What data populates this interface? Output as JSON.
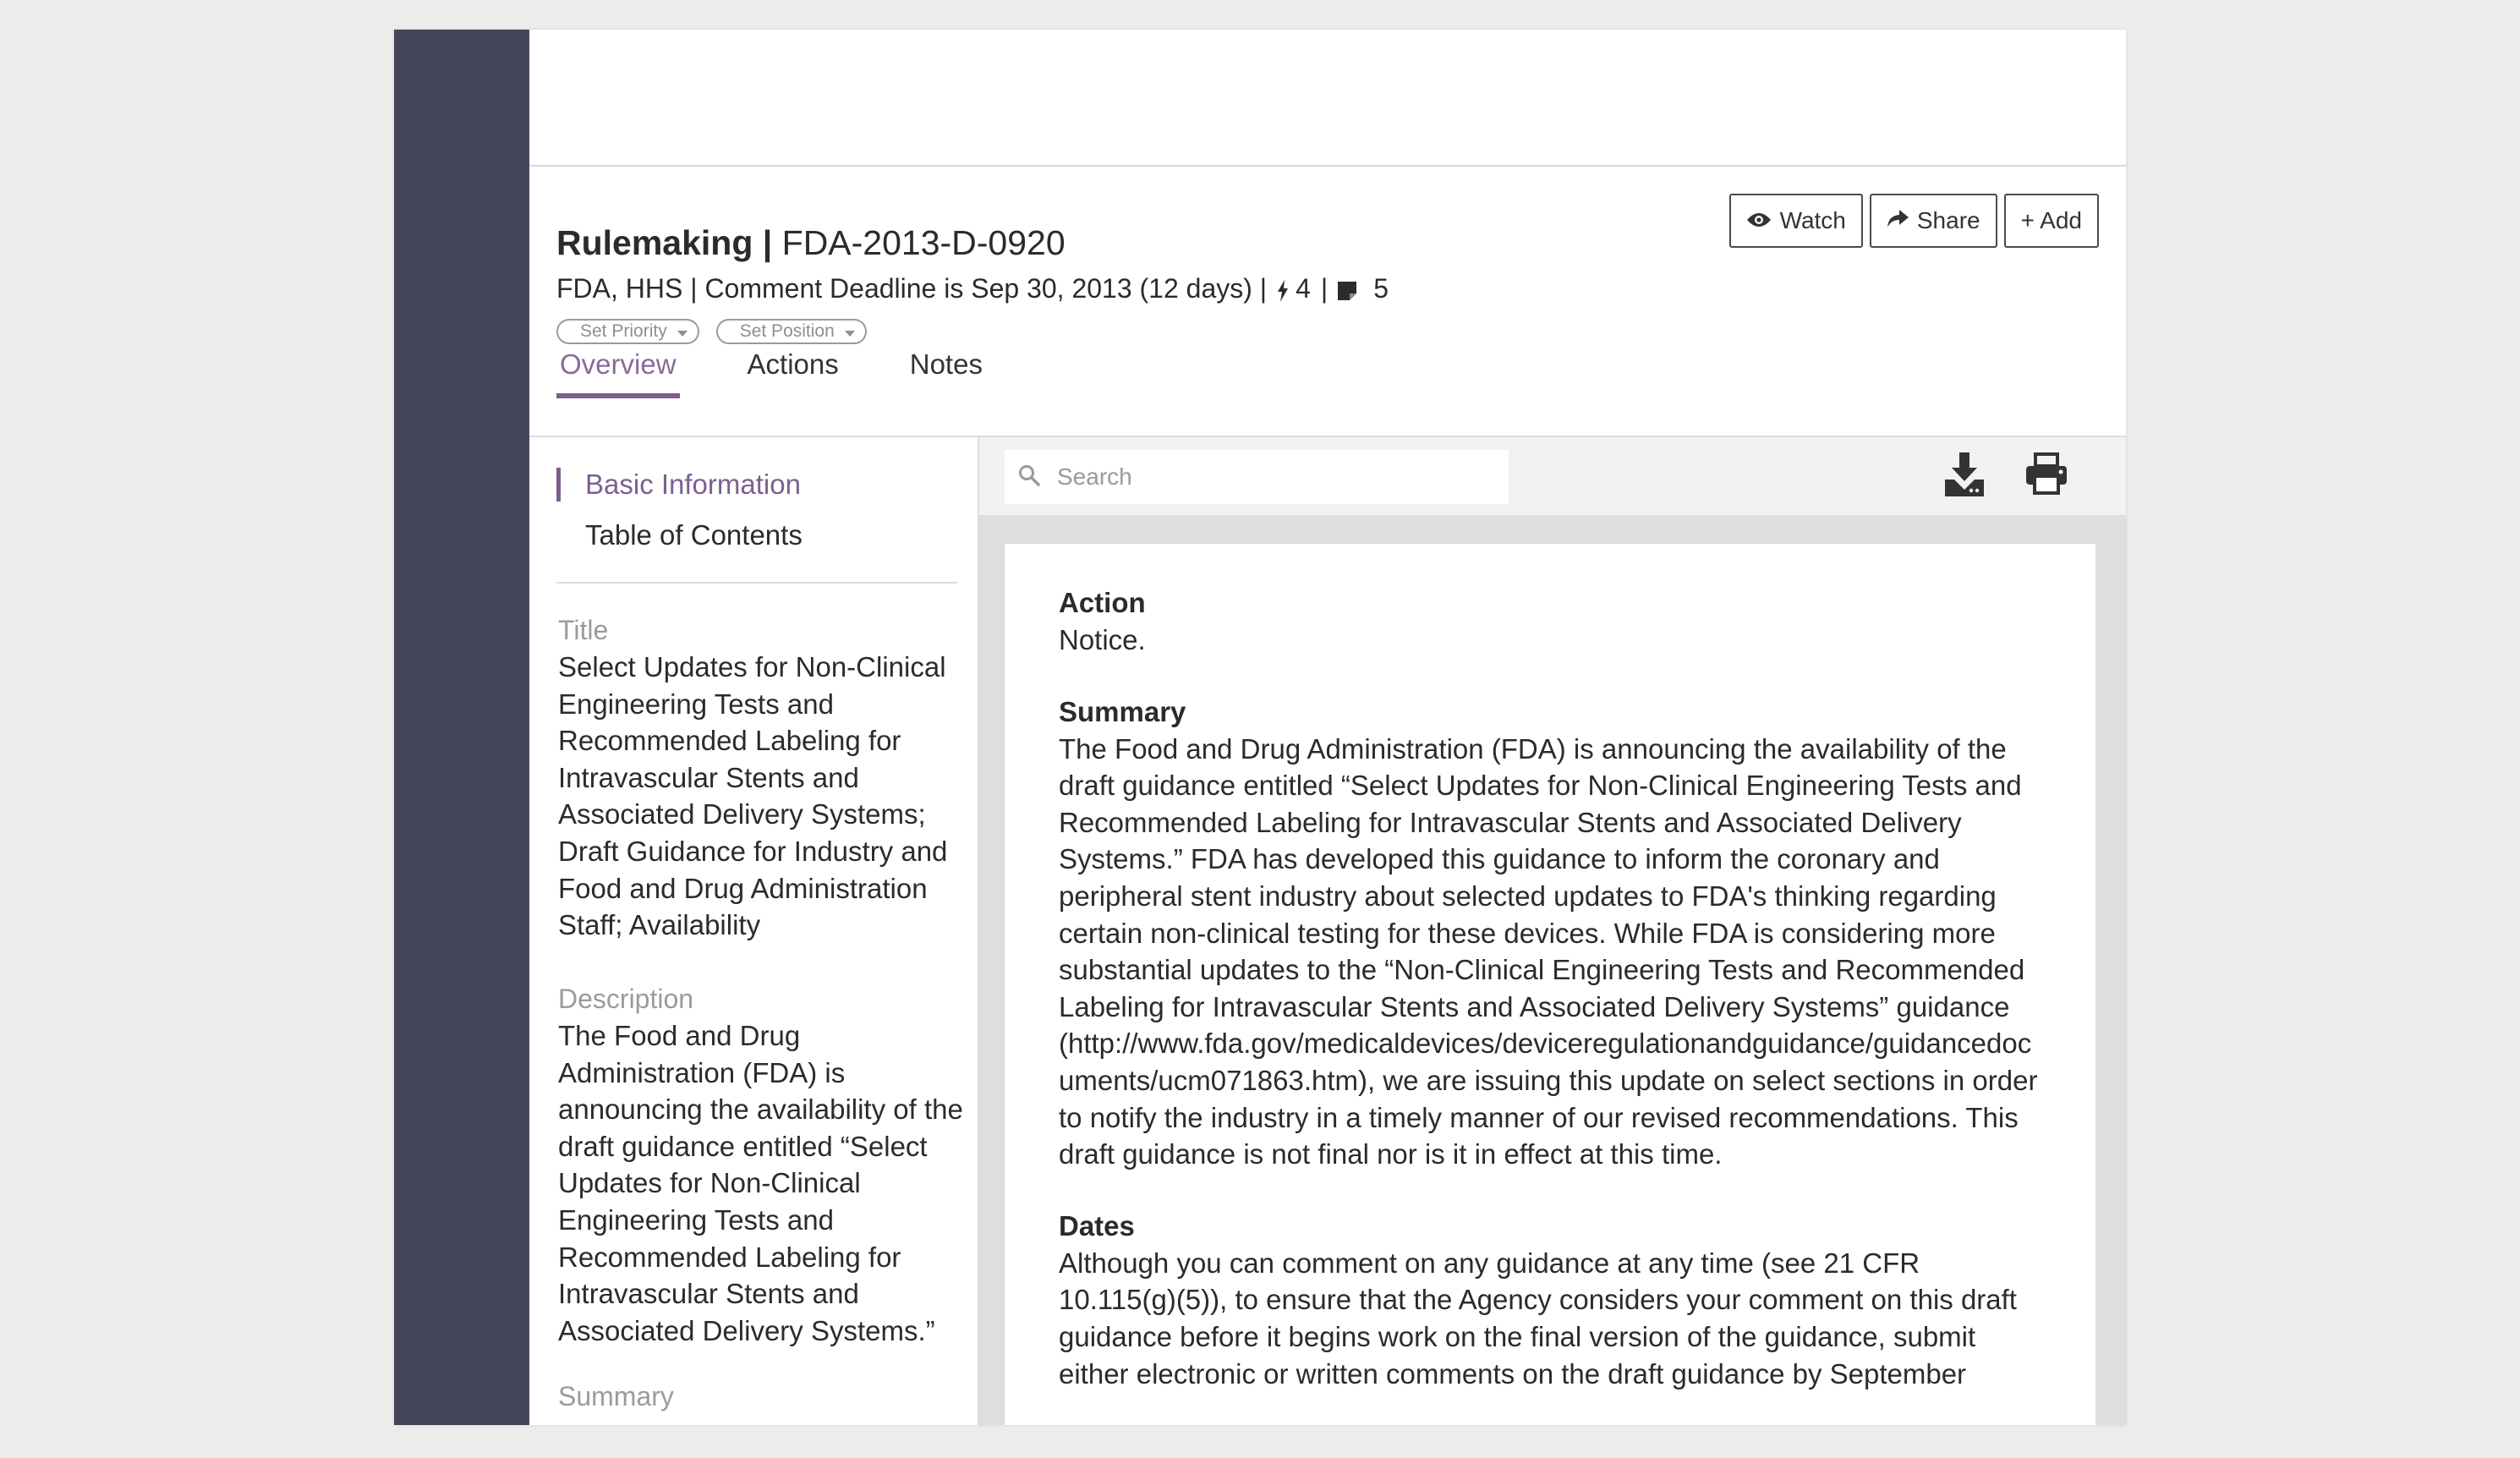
{
  "header": {
    "type_label": "Rulemaking",
    "separator": " | ",
    "docket_id": "FDA-2013-D-0920",
    "agency_line": "FDA, HHS | Comment Deadline is Sep 30, 2013 (12 days) |",
    "activity_count": "4",
    "mid_sep": "|",
    "notes_count": "5",
    "priority_label": "Set Priority",
    "position_label": "Set Position",
    "buttons": {
      "watch": "Watch",
      "share": "Share",
      "add": "+ Add"
    }
  },
  "tabs": [
    {
      "label": "Overview",
      "active": true
    },
    {
      "label": "Actions",
      "active": false
    },
    {
      "label": "Notes",
      "active": false
    }
  ],
  "left_nav": {
    "items": [
      "Basic Information",
      "Table of Contents"
    ],
    "title_label": "Title",
    "title_value": "Select Updates for Non-Clinical Engineering Tests and Recommended Labeling for Intravascular Stents and Associated Delivery Systems; Draft Guidance for Industry and Food and Drug Administration Staff; Availability",
    "description_label": "Description",
    "description_value": "The Food and Drug Administration (FDA) is announcing the availability of the draft guidance entitled “Select Updates for Non-Clinical Engineering Tests and Recommended Labeling for Intravascular Stents and Associated Delivery Systems.”",
    "summary_label": "Summary"
  },
  "toolbar": {
    "search_placeholder": "Search",
    "icons": [
      "search-icon",
      "download-icon",
      "print-icon"
    ]
  },
  "document": {
    "action_heading": "Action",
    "action_text": "Notice.",
    "summary_heading": "Summary",
    "summary_text": "The Food and Drug Administration (FDA) is announcing the availability of the draft guidance entitled “Select Updates for Non-Clinical Engineering Tests and Recommended Labeling for Intravascular Stents and Associated Delivery Systems.” FDA has developed this guidance to inform the coronary and peripheral stent industry about selected updates to FDA's thinking regarding certain non-clinical testing for these devices. While FDA is considering more substantial updates to the “Non-Clinical Engineering Tests and Recommended Labeling for Intravascular Stents and Associated Delivery Systems” guidance (http://www.fda.gov/medicaldevices/deviceregulationandguidance/guidancedocuments/ucm071863.htm), we are issuing this update on select sections in order to notify the industry in a timely manner of our revised recommendations. This draft guidance is not final nor is it in effect at this time.",
    "dates_heading": "Dates",
    "dates_text": "Although you can comment on any guidance at any time (see 21 CFR 10.115(g)(5)), to ensure that the Agency considers your comment on this draft guidance before it begins work on the final version of the guidance, submit either electronic or written comments on the draft guidance by September"
  },
  "colors": {
    "accent_purple": "#7d5d8f",
    "sidebar_dark": "#45455a",
    "background": "#ececec"
  }
}
